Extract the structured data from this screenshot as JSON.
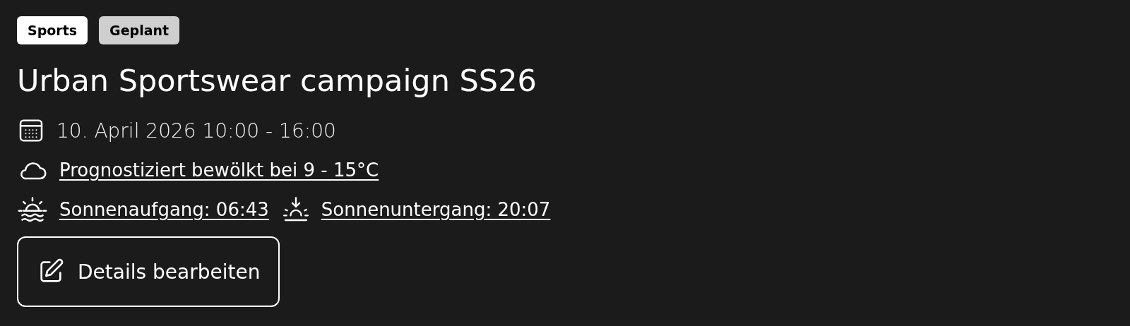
{
  "tags": [
    {
      "label": "Sports",
      "color": "#ffffff"
    },
    {
      "label": "Geplant",
      "color": "#cfcfcf"
    }
  ],
  "title": "Urban Sportswear campaign SS26",
  "info_rows": [
    {
      "items": [
        {
          "text": "10. April 2026 10:00 - 16:00",
          "kind": "date"
        }
      ]
    },
    {
      "items": [
        {
          "text": "Prognostiziert bewölkt bei 9 - 15°C",
          "kind": "weather"
        }
      ]
    },
    {
      "items": [
        {
          "text": "Sonnenaufgang: 06:43",
          "kind": "sunrise"
        },
        {
          "text": "Sonnenuntergang: 20:07",
          "kind": "sunset"
        }
      ]
    }
  ],
  "edit_button": {
    "label": "Details bearbeiten"
  }
}
